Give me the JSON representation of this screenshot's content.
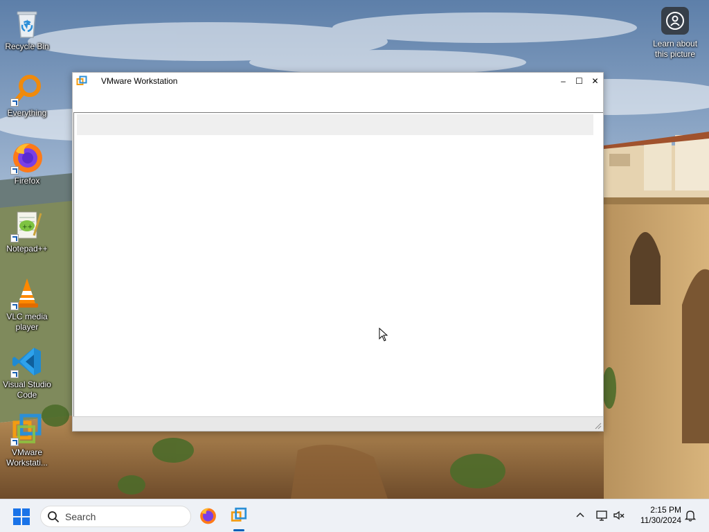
{
  "desktop": {
    "icons": [
      {
        "label": "Recycle Bin",
        "icon": "recycle-bin-icon"
      },
      {
        "label": "Everything",
        "icon": "everything-search-icon"
      },
      {
        "label": "Firefox",
        "icon": "firefox-icon"
      },
      {
        "label": "Notepad++",
        "icon": "notepad-plus-plus-icon"
      },
      {
        "label": "VLC media player",
        "icon": "vlc-cone-icon"
      },
      {
        "label": "Visual Studio Code",
        "icon": "vscode-icon"
      },
      {
        "label": "VMware Workstati...",
        "icon": "vmware-icon"
      }
    ],
    "learn_picture": {
      "label": "Learn about this picture",
      "icon": "camera-location-icon"
    }
  },
  "window": {
    "title": "VMware Workstation",
    "icon": "vmware-icon",
    "controls": {
      "minimize": "–",
      "maximize": "☐",
      "close": "✕"
    }
  },
  "taskbar": {
    "search_placeholder": "Search",
    "pinned_apps": [
      {
        "name": "Firefox",
        "icon": "firefox-icon",
        "active": false
      },
      {
        "name": "VMware Workstation",
        "icon": "vmware-icon",
        "active": true
      }
    ],
    "clock": {
      "time": "2:15 PM",
      "date": "11/30/2024"
    }
  },
  "colors": {
    "accent": "#005fb8",
    "taskbar_bg": "#eef1f6",
    "vmware_orange": "#f39c12",
    "vmware_blue": "#2b8fd6"
  }
}
